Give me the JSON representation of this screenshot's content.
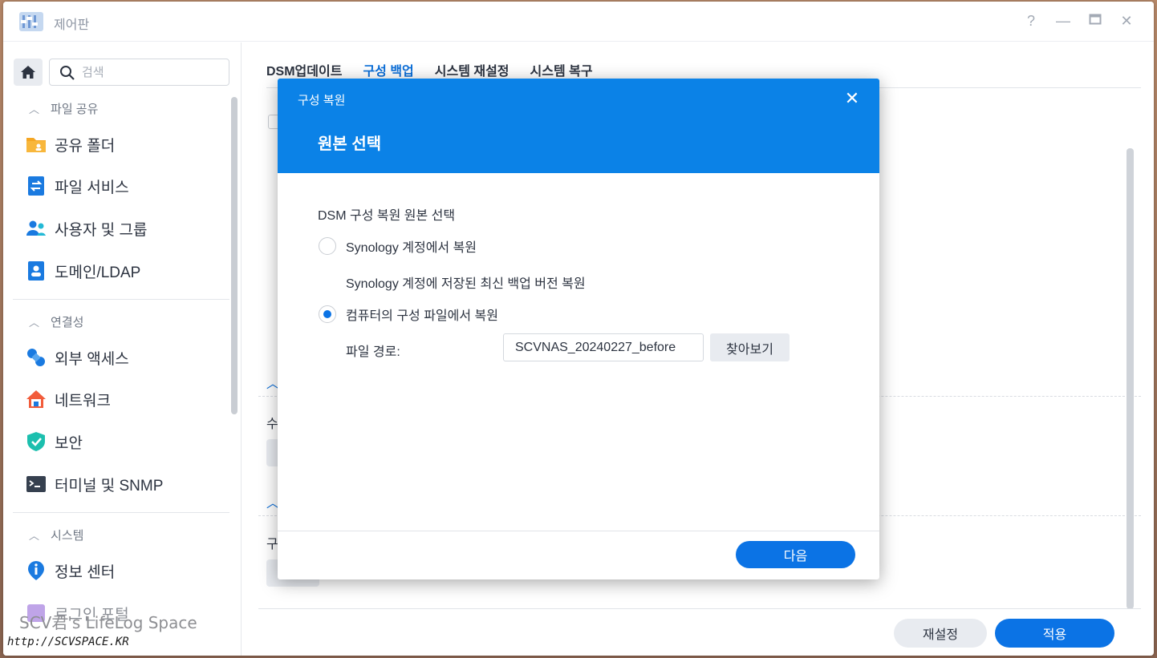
{
  "window": {
    "title": "제어판"
  },
  "search": {
    "placeholder": "검색"
  },
  "sidebar": {
    "sections": [
      {
        "label": "파일 공유",
        "items": [
          "공유 폴더",
          "파일 서비스",
          "사용자 및 그룹",
          "도메인/LDAP"
        ]
      },
      {
        "label": "연결성",
        "items": [
          "외부 액세스",
          "네트워크",
          "보안",
          "터미널 및 SNMP"
        ]
      },
      {
        "label": "시스템",
        "items": [
          "정보 센터",
          "로그인 포털"
        ]
      }
    ]
  },
  "tabs": [
    "DSM업데이트",
    "구성 백업",
    "시스템 재설정",
    "시스템 복구"
  ],
  "active_tab": "구성 백업",
  "background_fragments": {
    "text1": "수",
    "text2": "구"
  },
  "footer": {
    "reset_label": "재설정",
    "apply_label": "적용"
  },
  "dialog": {
    "title": "구성 복원",
    "subtitle": "원본 선택",
    "prompt": "DSM 구성 복원 원본 선택",
    "options": [
      {
        "label": "Synology 계정에서 복원",
        "selected": false
      },
      {
        "label": "컴퓨터의 구성 파일에서 복원",
        "selected": true
      }
    ],
    "option1_desc": "Synology 계정에 저장된 최신 백업 버전 복원",
    "path_label": "파일 경로:",
    "path_value": "SCVNAS_20240227_before",
    "browse_label": "찾아보기",
    "next_label": "다음"
  },
  "watermark": {
    "line1": "SCV君's LifeLog Space",
    "line2": "http://SCVSPACE.KR"
  },
  "colors": {
    "accent": "#0b73e5",
    "dialog_header": "#0b82e7"
  }
}
